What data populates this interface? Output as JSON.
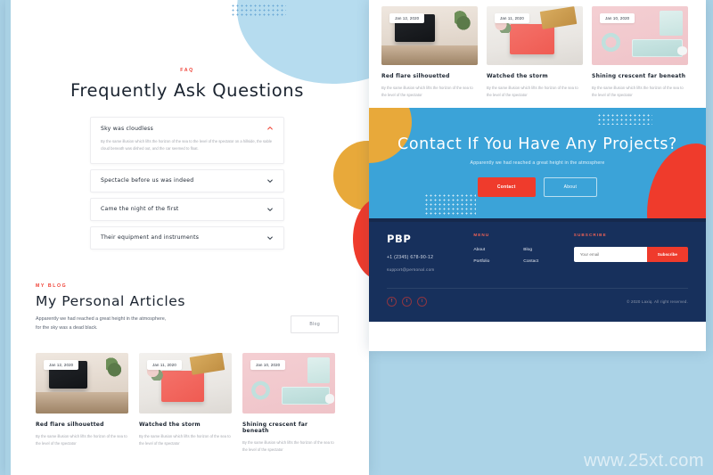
{
  "watermark": "www.25xt.com",
  "left_panel": {
    "faq": {
      "eyebrow": "FAQ",
      "title": "Frequently Ask Questions",
      "items": [
        {
          "question": "Sky was cloudless",
          "answer": "By the same illusion which lifts the horizon of the sea to the level of the spectator on a hillside, the sable cloud beneath was dished out, and the car seemed to float.",
          "open": true,
          "icon": "chevron-up-icon"
        },
        {
          "question": "Spectacle before us was indeed",
          "answer": "",
          "open": false,
          "icon": "chevron-down-icon"
        },
        {
          "question": "Came the night of the first",
          "answer": "",
          "open": false,
          "icon": "chevron-down-icon"
        },
        {
          "question": "Their equipment and instruments",
          "answer": "",
          "open": false,
          "icon": "chevron-down-icon"
        }
      ]
    },
    "blog": {
      "eyebrow": "MY BLOG",
      "title": "My Personal Articles",
      "subtitle": "Apparently we had reached a great height in the atmosphere, for the sky was a dead black.",
      "button": "Blog",
      "cards": [
        {
          "date": "Jan 12, 2020",
          "title": "Red flare silhouetted",
          "desc": "By the same illusion which lifts the horizon of the sea to the level of the spectator"
        },
        {
          "date": "Jan 11, 2020",
          "title": "Watched the storm",
          "desc": "By the same illusion which lifts the horizon of the sea to the level of the spectator"
        },
        {
          "date": "Jan 10, 2020",
          "title": "Shining crescent far beneath",
          "desc": "By the same illusion which lifts the horizon of the sea to the level of the spectator"
        }
      ]
    }
  },
  "right_panel": {
    "cards": [
      {
        "date": "Jan 12, 2020",
        "title": "Red flare silhouetted",
        "desc": "By the same illusion which lifts the horizon of the sea to the level of the spectator"
      },
      {
        "date": "Jan 11, 2020",
        "title": "Watched the storm",
        "desc": "By the same illusion which lifts the horizon of the sea to the level of the spectator"
      },
      {
        "date": "Jan 10, 2020",
        "title": "Shining crescent far beneath",
        "desc": "By the same illusion which lifts the horizon of the sea to the level of the spectator"
      }
    ],
    "cta": {
      "title": "Contact If You Have Any Projects?",
      "subtitle": "Apparently we had reached a great height in the atmosphere",
      "primary_button": "Contact",
      "secondary_button": "About"
    },
    "footer": {
      "logo": "PBP",
      "phone": "+1 (2345) 678-90-12",
      "email": "support@personal.com",
      "menu_heading": "MENU",
      "menu_col1": [
        "About",
        "Portfolio"
      ],
      "menu_col2": [
        "Blog",
        "Contact"
      ],
      "subscribe_heading": "SUBSCRIBE",
      "subscribe_placeholder": "Your email",
      "subscribe_button": "Subscribe",
      "socials": [
        "f",
        "t",
        "i"
      ],
      "copyright": "© 2020 Laxiq. All right reserved."
    }
  },
  "colors": {
    "brand_red": "#ef3b2c",
    "cta_blue": "#3ba3d8",
    "footer_navy": "#17305c",
    "gold": "#e8a93a",
    "page_bg": "#abd3e7"
  }
}
